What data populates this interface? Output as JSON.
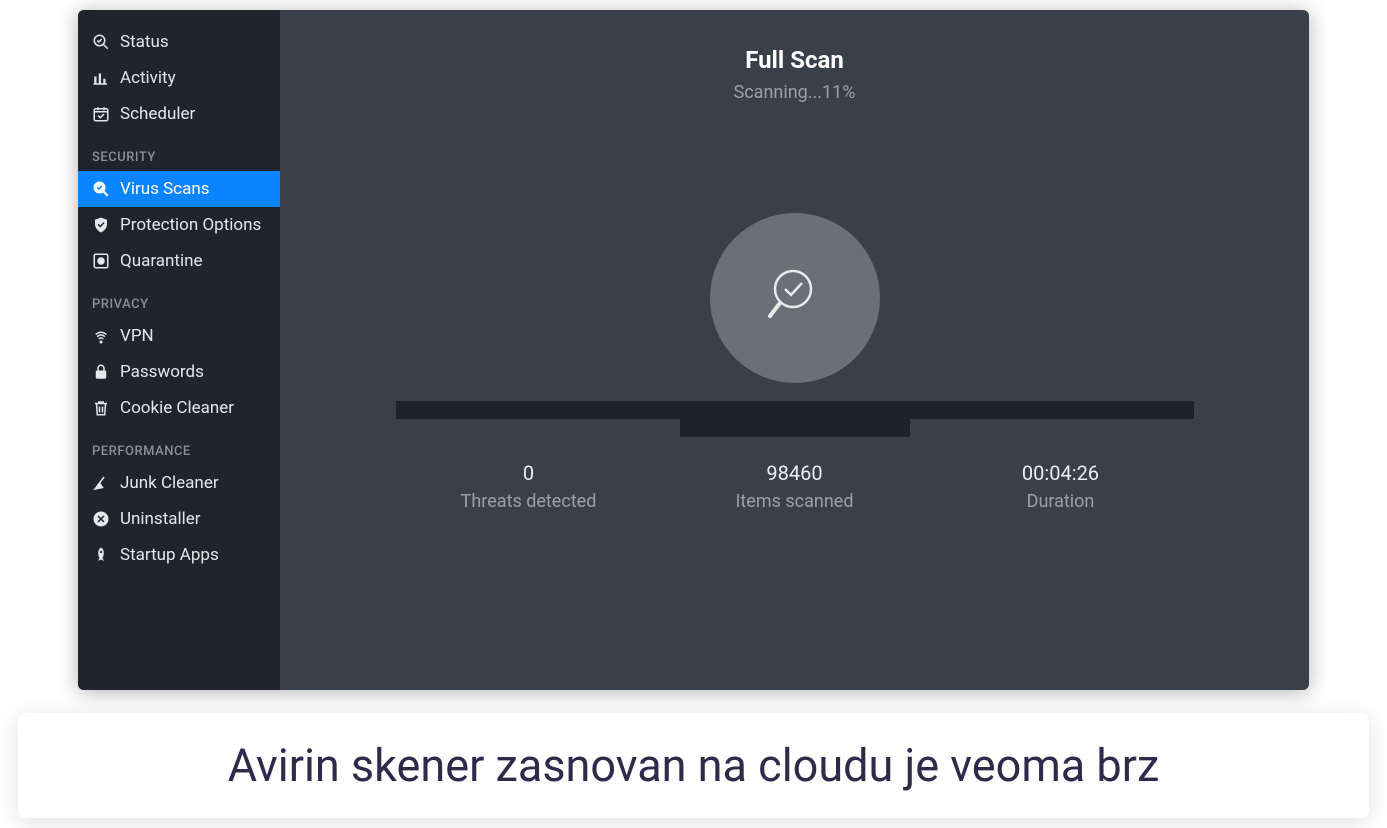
{
  "sidebar": {
    "top": [
      {
        "icon": "status",
        "label": "Status"
      },
      {
        "icon": "activity",
        "label": "Activity"
      },
      {
        "icon": "scheduler",
        "label": "Scheduler"
      }
    ],
    "security_header": "SECURITY",
    "security": [
      {
        "icon": "virus-scan",
        "label": "Virus Scans",
        "active": true
      },
      {
        "icon": "shield",
        "label": "Protection Options"
      },
      {
        "icon": "quarantine",
        "label": "Quarantine"
      }
    ],
    "privacy_header": "PRIVACY",
    "privacy": [
      {
        "icon": "vpn",
        "label": "VPN"
      },
      {
        "icon": "lock",
        "label": "Passwords"
      },
      {
        "icon": "trash",
        "label": "Cookie Cleaner"
      }
    ],
    "performance_header": "PERFORMANCE",
    "performance": [
      {
        "icon": "broom",
        "label": "Junk Cleaner"
      },
      {
        "icon": "x-circle",
        "label": "Uninstaller"
      },
      {
        "icon": "rocket",
        "label": "Startup Apps"
      }
    ]
  },
  "scan": {
    "title": "Full Scan",
    "status": "Scanning...11%",
    "stats": {
      "threats": {
        "value": "0",
        "label": "Threats detected"
      },
      "items": {
        "value": "98460",
        "label": "Items scanned"
      },
      "duration": {
        "value": "00:04:26",
        "label": "Duration"
      }
    }
  },
  "caption": "Avirin skener zasnovan na cloudu je veoma brz"
}
